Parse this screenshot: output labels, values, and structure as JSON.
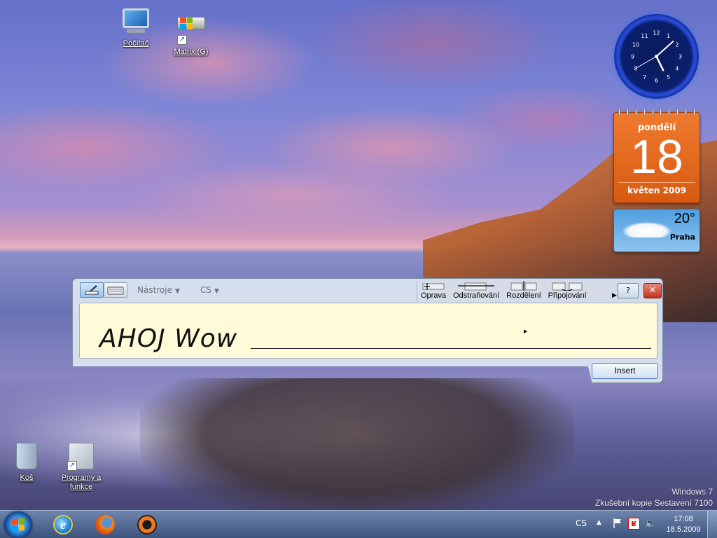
{
  "desktop": {
    "icons": [
      {
        "label": "Počítač",
        "icon": "computer-icon"
      },
      {
        "label": "Matrix (G)",
        "icon": "drive-icon"
      },
      {
        "label": "Koš",
        "icon": "recycle-bin-icon"
      },
      {
        "label": "Programy a funkce",
        "icon": "programs-icon"
      }
    ]
  },
  "gadgets": {
    "clock": {
      "hour": 17,
      "minute": 8,
      "numbers": [
        "12",
        "1",
        "2",
        "3",
        "4",
        "5",
        "6",
        "7",
        "8",
        "9",
        "10",
        "11"
      ]
    },
    "calendar": {
      "day_name": "pondělí",
      "date": "18",
      "month_year": "květen 2009"
    },
    "weather": {
      "temperature": "20°",
      "city": "Praha"
    }
  },
  "tip": {
    "tools_menu": "Nástroje",
    "language_menu": "CS",
    "actions": [
      "Oprava",
      "Odstraňování",
      "Rozdělení",
      "Připojování"
    ],
    "ink_text": "AHOJ Wow",
    "insert_label": "Insert",
    "close_label": "✕",
    "help_label": "?"
  },
  "watermark": {
    "line1": "Windows 7",
    "line2": "Zkušební kopie Sestavení 7100"
  },
  "taskbar": {
    "pinned": [
      "internet-explorer-icon",
      "firefox-icon",
      "reason-icon"
    ],
    "language": "CS",
    "time": "17:08",
    "date": "18.5.2009"
  },
  "colors": {
    "calendar_orange": "#e56a1f",
    "tip_writing_pad": "#fffbd8",
    "close_red": "#c2321c"
  }
}
